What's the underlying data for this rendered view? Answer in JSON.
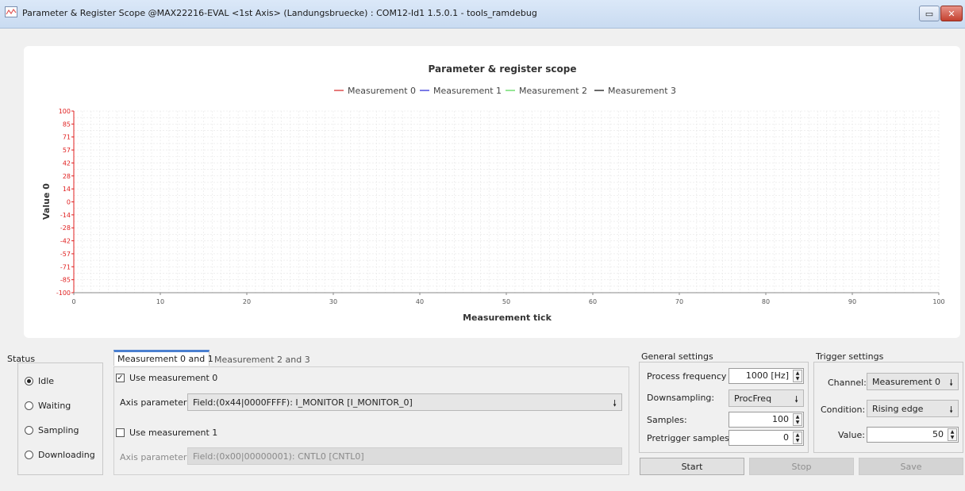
{
  "window": {
    "title": "Parameter & Register Scope @MAX22216-EVAL <1st Axis> (Landungsbruecke) : COM12-Id1 1.5.0.1 - tools_ramdebug",
    "restore_glyph": "▭",
    "close_glyph": "✕"
  },
  "chart_data": {
    "type": "line",
    "title": "Parameter & register scope",
    "xlabel": "Measurement tick",
    "ylabel": "Value 0",
    "xlim": [
      0,
      100
    ],
    "ylim": [
      -100,
      100
    ],
    "x_ticks": [
      0,
      10,
      20,
      30,
      40,
      50,
      60,
      70,
      80,
      90,
      100
    ],
    "y_ticks": [
      100,
      85,
      71,
      57,
      42,
      28,
      14,
      0,
      -14,
      -28,
      -42,
      -57,
      -71,
      -85,
      -100
    ],
    "grid": true,
    "legend_position": "top-center",
    "series": [
      {
        "name": "Measurement 0",
        "color": "#e05a5a",
        "values": []
      },
      {
        "name": "Measurement 1",
        "color": "#5a5ae0",
        "values": []
      },
      {
        "name": "Measurement 2",
        "color": "#7be07b",
        "values": []
      },
      {
        "name": "Measurement 3",
        "color": "#444444",
        "values": []
      }
    ],
    "axis_color_y": "#e02020"
  },
  "status": {
    "label": "Status",
    "options": [
      {
        "label": "Idle",
        "selected": true
      },
      {
        "label": "Waiting",
        "selected": false
      },
      {
        "label": "Sampling",
        "selected": false
      },
      {
        "label": "Downloading",
        "selected": false
      }
    ]
  },
  "measurement_tabs": {
    "tabs": [
      {
        "label": "Measurement 0 and 1",
        "active": true
      },
      {
        "label": "Measurement 2 and 3",
        "active": false
      }
    ],
    "m0": {
      "use_label": "Use measurement 0",
      "checked_glyph": "✓",
      "axis_label": "Axis parameter:",
      "axis_value": "Field:(0x44|0000FFFF): I_MONITOR [I_MONITOR_0]"
    },
    "m1": {
      "use_label": "Use measurement 1",
      "axis_label": "Axis parameter:",
      "axis_value": "Field:(0x00|00000001): CNTL0 [CNTL0]"
    }
  },
  "general": {
    "label": "General settings",
    "process_frequency_label": "Process frequency",
    "process_frequency_value": "1000 [Hz]",
    "downsampling_label": "Downsampling:",
    "downsampling_value": "ProcFreq",
    "samples_label": "Samples:",
    "samples_value": "100",
    "pretrigger_label": "Pretrigger samples:",
    "pretrigger_value": "0"
  },
  "trigger": {
    "label": "Trigger settings",
    "channel_label": "Channel:",
    "channel_value": "Measurement 0",
    "condition_label": "Condition:",
    "condition_value": "Rising edge",
    "value_label": "Value:",
    "value_value": "50"
  },
  "actions": {
    "start": "Start",
    "stop": "Stop",
    "save": "Save"
  },
  "icons": {
    "dropdown_arrow": "🠗",
    "spin_up": "▲",
    "spin_down": "▼"
  }
}
